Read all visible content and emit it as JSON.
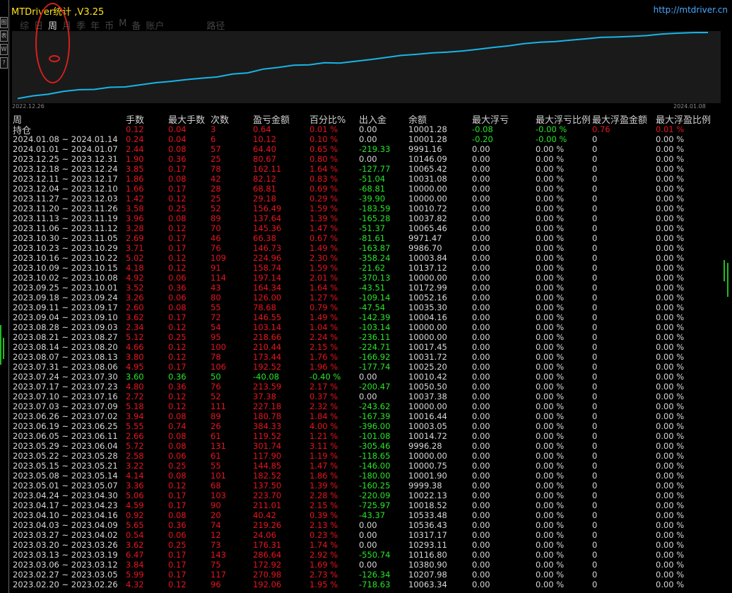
{
  "app": {
    "title": "MTDriver统计 ,V3.25",
    "url": "http://mtdriver.cn"
  },
  "tabs": [
    "综",
    "日",
    "周",
    "月",
    "季",
    "年",
    "币",
    "M",
    "备",
    "账户",
    "路径"
  ],
  "active_tab": 2,
  "side_buttons": [
    "图",
    "表",
    "W",
    "?"
  ],
  "chart": {
    "start_date": "2022.12.26",
    "end_date": "2024.01.08",
    "line_color": "#19b4e6"
  },
  "columns": [
    "周",
    "手数",
    "最大手数",
    "次数",
    "盈亏金额",
    "百分比%",
    "出入金",
    "余额",
    "最大浮亏",
    "最大浮亏比例",
    "最大浮盈金额",
    "最大浮盈比例"
  ],
  "holding_label": "持仓",
  "holding_row": [
    "0.12",
    "0.04",
    "3",
    "0.64",
    "0.01 %",
    "0.00",
    "10001.28",
    "-0.08",
    "-0.00 %",
    "0.76",
    "0.01 %"
  ],
  "rows": [
    [
      "2024.01.08 ~ 2024.01.14",
      "0.24",
      "0.04",
      "6",
      "10.12",
      "0.10 %",
      "0.00",
      "10001.28",
      "-0.20",
      "-0.00 %",
      "0",
      "0.00 %"
    ],
    [
      "2024.01.01 ~ 2024.01.07",
      "2.44",
      "0.08",
      "57",
      "64.40",
      "0.65 %",
      "-219.33",
      "9991.16",
      "0.00",
      "0.00 %",
      "0",
      "0.00 %"
    ],
    [
      "2023.12.25 ~ 2023.12.31",
      "1.90",
      "0.36",
      "25",
      "80.67",
      "0.80 %",
      "0.00",
      "10146.09",
      "0.00",
      "0.00 %",
      "0",
      "0.00 %"
    ],
    [
      "2023.12.18 ~ 2023.12.24",
      "3.85",
      "0.17",
      "78",
      "162.11",
      "1.64 %",
      "-127.77",
      "10065.42",
      "0.00",
      "0.00 %",
      "0",
      "0.00 %"
    ],
    [
      "2023.12.11 ~ 2023.12.17",
      "1.86",
      "0.08",
      "42",
      "82.12",
      "0.83 %",
      "-51.04",
      "10031.08",
      "0.00",
      "0.00 %",
      "0",
      "0.00 %"
    ],
    [
      "2023.12.04 ~ 2023.12.10",
      "1.66",
      "0.17",
      "28",
      "68.81",
      "0.69 %",
      "-68.81",
      "10000.00",
      "0.00",
      "0.00 %",
      "0",
      "0.00 %"
    ],
    [
      "2023.11.27 ~ 2023.12.03",
      "1.42",
      "0.12",
      "25",
      "29.18",
      "0.29 %",
      "-39.90",
      "10000.00",
      "0.00",
      "0.00 %",
      "0",
      "0.00 %"
    ],
    [
      "2023.11.20 ~ 2023.11.26",
      "3.58",
      "0.25",
      "52",
      "156.49",
      "1.59 %",
      "-183.59",
      "10010.72",
      "0.00",
      "0.00 %",
      "0",
      "0.00 %"
    ],
    [
      "2023.11.13 ~ 2023.11.19",
      "3.96",
      "0.08",
      "89",
      "137.64",
      "1.39 %",
      "-165.28",
      "10037.82",
      "0.00",
      "0.00 %",
      "0",
      "0.00 %"
    ],
    [
      "2023.11.06 ~ 2023.11.12",
      "3.28",
      "0.12",
      "70",
      "145.36",
      "1.47 %",
      "-51.37",
      "10065.46",
      "0.00",
      "0.00 %",
      "0",
      "0.00 %"
    ],
    [
      "2023.10.30 ~ 2023.11.05",
      "2.69",
      "0.17",
      "46",
      "66.38",
      "0.67 %",
      "-81.61",
      "9971.47",
      "0.00",
      "0.00 %",
      "0",
      "0.00 %"
    ],
    [
      "2023.10.23 ~ 2023.10.29",
      "3.71",
      "0.17",
      "76",
      "146.73",
      "1.49 %",
      "-163.87",
      "9986.70",
      "0.00",
      "0.00 %",
      "0",
      "0.00 %"
    ],
    [
      "2023.10.16 ~ 2023.10.22",
      "5.02",
      "0.12",
      "109",
      "224.96",
      "2.30 %",
      "-358.24",
      "10003.84",
      "0.00",
      "0.00 %",
      "0",
      "0.00 %"
    ],
    [
      "2023.10.09 ~ 2023.10.15",
      "4.18",
      "0.12",
      "91",
      "158.74",
      "1.59 %",
      "-21.62",
      "10137.12",
      "0.00",
      "0.00 %",
      "0",
      "0.00 %"
    ],
    [
      "2023.10.02 ~ 2023.10.08",
      "4.92",
      "0.06",
      "114",
      "197.14",
      "2.01 %",
      "-370.13",
      "10000.00",
      "0.00",
      "0.00 %",
      "0",
      "0.00 %"
    ],
    [
      "2023.09.25 ~ 2023.10.01",
      "3.52",
      "0.36",
      "43",
      "164.34",
      "1.64 %",
      "-43.51",
      "10172.99",
      "0.00",
      "0.00 %",
      "0",
      "0.00 %"
    ],
    [
      "2023.09.18 ~ 2023.09.24",
      "3.26",
      "0.06",
      "80",
      "126.00",
      "1.27 %",
      "-109.14",
      "10052.16",
      "0.00",
      "0.00 %",
      "0",
      "0.00 %"
    ],
    [
      "2023.09.11 ~ 2023.09.17",
      "2.60",
      "0.08",
      "55",
      "78.68",
      "0.79 %",
      "-47.54",
      "10035.30",
      "0.00",
      "0.00 %",
      "0",
      "0.00 %"
    ],
    [
      "2023.09.04 ~ 2023.09.10",
      "3.62",
      "0.17",
      "72",
      "146.55",
      "1.49 %",
      "-142.39",
      "10004.16",
      "0.00",
      "0.00 %",
      "0",
      "0.00 %"
    ],
    [
      "2023.08.28 ~ 2023.09.03",
      "2.34",
      "0.12",
      "54",
      "103.14",
      "1.04 %",
      "-103.14",
      "10000.00",
      "0.00",
      "0.00 %",
      "0",
      "0.00 %"
    ],
    [
      "2023.08.21 ~ 2023.08.27",
      "5.12",
      "0.25",
      "95",
      "218.66",
      "2.24 %",
      "-236.11",
      "10000.00",
      "0.00",
      "0.00 %",
      "0",
      "0.00 %"
    ],
    [
      "2023.08.14 ~ 2023.08.20",
      "4.66",
      "0.12",
      "100",
      "210.44",
      "2.15 %",
      "-224.71",
      "10017.45",
      "0.00",
      "0.00 %",
      "0",
      "0.00 %"
    ],
    [
      "2023.08.07 ~ 2023.08.13",
      "3.80",
      "0.12",
      "78",
      "173.44",
      "1.76 %",
      "-166.92",
      "10031.72",
      "0.00",
      "0.00 %",
      "0",
      "0.00 %"
    ],
    [
      "2023.07.31 ~ 2023.08.06",
      "4.95",
      "0.17",
      "106",
      "192.52",
      "1.96 %",
      "-177.74",
      "10025.20",
      "0.00",
      "0.00 %",
      "0",
      "0.00 %"
    ],
    [
      "2023.07.24 ~ 2023.07.30",
      "3.60",
      "0.36",
      "50",
      "-40.08",
      "-0.40 %",
      "0.00",
      "10010.42",
      "0.00",
      "0.00 %",
      "0",
      "0.00 %"
    ],
    [
      "2023.07.17 ~ 2023.07.23",
      "4.80",
      "0.36",
      "76",
      "213.59",
      "2.17 %",
      "-200.47",
      "10050.50",
      "0.00",
      "0.00 %",
      "0",
      "0.00 %"
    ],
    [
      "2023.07.10 ~ 2023.07.16",
      "2.72",
      "0.12",
      "52",
      "37.38",
      "0.37 %",
      "0.00",
      "10037.38",
      "0.00",
      "0.00 %",
      "0",
      "0.00 %"
    ],
    [
      "2023.07.03 ~ 2023.07.09",
      "5.18",
      "0.12",
      "111",
      "227.18",
      "2.32 %",
      "-243.62",
      "10000.00",
      "0.00",
      "0.00 %",
      "0",
      "0.00 %"
    ],
    [
      "2023.06.26 ~ 2023.07.02",
      "3.94",
      "0.08",
      "89",
      "180.78",
      "1.84 %",
      "-167.39",
      "10016.44",
      "0.00",
      "0.00 %",
      "0",
      "0.00 %"
    ],
    [
      "2023.06.19 ~ 2023.06.25",
      "5.55",
      "0.74",
      "26",
      "384.33",
      "4.00 %",
      "-396.00",
      "10003.05",
      "0.00",
      "0.00 %",
      "0",
      "0.00 %"
    ],
    [
      "2023.06.05 ~ 2023.06.11",
      "2.66",
      "0.08",
      "61",
      "119.52",
      "1.21 %",
      "-101.08",
      "10014.72",
      "0.00",
      "0.00 %",
      "0",
      "0.00 %"
    ],
    [
      "2023.05.29 ~ 2023.06.04",
      "5.72",
      "0.08",
      "131",
      "301.74",
      "3.11 %",
      "-305.46",
      "9996.28",
      "0.00",
      "0.00 %",
      "0",
      "0.00 %"
    ],
    [
      "2023.05.22 ~ 2023.05.28",
      "2.58",
      "0.06",
      "61",
      "117.90",
      "1.19 %",
      "-118.65",
      "10000.00",
      "0.00",
      "0.00 %",
      "0",
      "0.00 %"
    ],
    [
      "2023.05.15 ~ 2023.05.21",
      "3.22",
      "0.25",
      "55",
      "144.85",
      "1.47 %",
      "-146.00",
      "10000.75",
      "0.00",
      "0.00 %",
      "0",
      "0.00 %"
    ],
    [
      "2023.05.08 ~ 2023.05.14",
      "4.14",
      "0.08",
      "101",
      "182.52",
      "1.86 %",
      "-180.00",
      "10001.90",
      "0.00",
      "0.00 %",
      "0",
      "0.00 %"
    ],
    [
      "2023.05.01 ~ 2023.05.07",
      "3.36",
      "0.12",
      "68",
      "137.50",
      "1.39 %",
      "-160.25",
      "9999.38",
      "0.00",
      "0.00 %",
      "0",
      "0.00 %"
    ],
    [
      "2023.04.24 ~ 2023.04.30",
      "5.06",
      "0.17",
      "103",
      "223.70",
      "2.28 %",
      "-220.09",
      "10022.13",
      "0.00",
      "0.00 %",
      "0",
      "0.00 %"
    ],
    [
      "2023.04.17 ~ 2023.04.23",
      "4.59",
      "0.17",
      "90",
      "211.01",
      "2.15 %",
      "-725.97",
      "10018.52",
      "0.00",
      "0.00 %",
      "0",
      "0.00 %"
    ],
    [
      "2023.04.10 ~ 2023.04.16",
      "0.92",
      "0.08",
      "20",
      "40.42",
      "0.39 %",
      "-43.37",
      "10533.48",
      "0.00",
      "0.00 %",
      "0",
      "0.00 %"
    ],
    [
      "2023.04.03 ~ 2023.04.09",
      "5.65",
      "0.36",
      "74",
      "219.26",
      "2.13 %",
      "0.00",
      "10536.43",
      "0.00",
      "0.00 %",
      "0",
      "0.00 %"
    ],
    [
      "2023.03.27 ~ 2023.04.02",
      "0.54",
      "0.06",
      "12",
      "24.06",
      "0.23 %",
      "0.00",
      "10317.17",
      "0.00",
      "0.00 %",
      "0",
      "0.00 %"
    ],
    [
      "2023.03.20 ~ 2023.03.26",
      "3.62",
      "0.25",
      "73",
      "176.31",
      "1.74 %",
      "0.00",
      "10293.11",
      "0.00",
      "0.00 %",
      "0",
      "0.00 %"
    ],
    [
      "2023.03.13 ~ 2023.03.19",
      "6.47",
      "0.17",
      "143",
      "286.64",
      "2.92 %",
      "-550.74",
      "10116.80",
      "0.00",
      "0.00 %",
      "0",
      "0.00 %"
    ],
    [
      "2023.03.06 ~ 2023.03.12",
      "3.84",
      "0.17",
      "75",
      "172.92",
      "1.69 %",
      "0.00",
      "10380.90",
      "0.00",
      "0.00 %",
      "0",
      "0.00 %"
    ],
    [
      "2023.02.27 ~ 2023.03.05",
      "5.99",
      "0.17",
      "117",
      "270.98",
      "2.73 %",
      "-126.34",
      "10207.98",
      "0.00",
      "0.00 %",
      "0",
      "0.00 %"
    ],
    [
      "2023.02.20 ~ 2023.02.26",
      "4.32",
      "0.12",
      "96",
      "192.06",
      "1.95 %",
      "-718.63",
      "10063.34",
      "0.00",
      "0.00 %",
      "0",
      "0.00 %"
    ]
  ],
  "colors": {
    "positive": "#e8141e",
    "negative": "#26e626",
    "neutral": "#d8d8d8",
    "title": "#ffe21a",
    "url": "#4aa8ff"
  }
}
